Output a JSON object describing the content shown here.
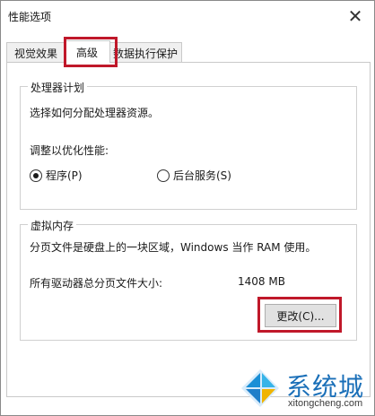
{
  "window": {
    "title": "性能选项",
    "close_glyph": "✕"
  },
  "tabs": [
    {
      "label": "视觉效果",
      "active": false
    },
    {
      "label": "高级",
      "active": true
    },
    {
      "label": "数据执行保护",
      "active": false
    }
  ],
  "processor_group": {
    "legend": "处理器计划",
    "description": "选择如何分配处理器资源。",
    "optimize_label": "调整以优化性能:",
    "options": [
      {
        "label": "程序(P)",
        "selected": true
      },
      {
        "label": "后台服务(S)",
        "selected": false
      }
    ]
  },
  "virtual_memory_group": {
    "legend": "虚拟内存",
    "description": "分页文件是硬盘上的一块区域，Windows 当作 RAM 使用。",
    "total_label": "所有驱动器总分页文件大小:",
    "total_value": "1408 MB",
    "change_button": "更改(C)..."
  },
  "watermark": {
    "brand": "系统城",
    "url": "xitongcheng.com"
  },
  "colors": {
    "highlight": "#c0182a",
    "brand_blue": "#1a6fb8"
  }
}
